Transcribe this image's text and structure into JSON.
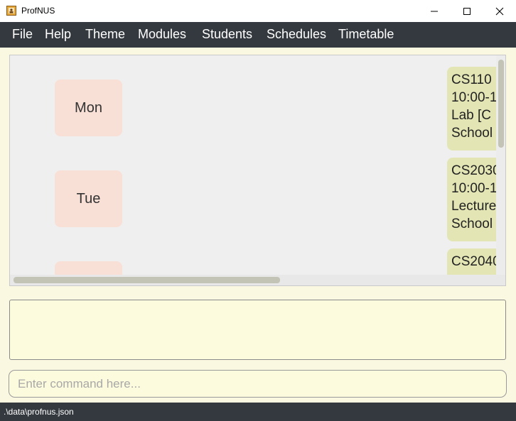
{
  "window": {
    "title": "ProfNUS",
    "icon": "app-icon",
    "controls": [
      "minimize-icon",
      "maximize-icon",
      "close-icon"
    ]
  },
  "menu": {
    "items": [
      {
        "label": "File"
      },
      {
        "label": "Help"
      },
      {
        "label": "Theme"
      },
      {
        "label": "Modules"
      },
      {
        "label": "Students"
      },
      {
        "label": "Schedules"
      },
      {
        "label": "Timetable"
      }
    ]
  },
  "timetable": {
    "days": [
      {
        "label": "Mon"
      },
      {
        "label": "Tue"
      },
      {
        "label": ""
      }
    ],
    "slots": [
      {
        "line1": "CS110",
        "line2": "10:00-1",
        "line3": "Lab  [C",
        "line4": "School"
      },
      {
        "line1": "CS2030",
        "line2": "10:00-1",
        "line3": "Lecture",
        "line4": "School"
      },
      {
        "line1": "CS2040",
        "line2": "",
        "line3": "",
        "line4": ""
      }
    ]
  },
  "result": {
    "text": ""
  },
  "command": {
    "placeholder": "Enter command here...",
    "value": ""
  },
  "status": {
    "path": ".\\data\\profnus.json"
  },
  "colors": {
    "menubar": "#34393f",
    "background": "#fbf8e1",
    "day_box": "#f8e0d6",
    "slot_card": "#e3e6b4"
  }
}
